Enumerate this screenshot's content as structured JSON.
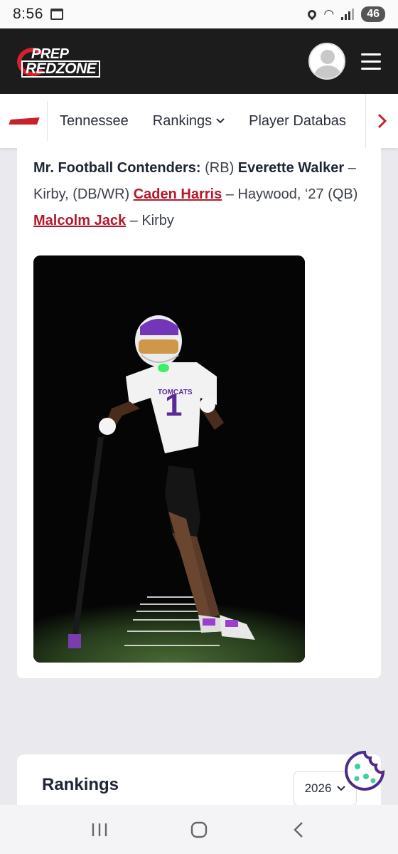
{
  "status_bar": {
    "time": "8:56",
    "battery": "46",
    "icons": [
      "calendar-icon",
      "location-icon",
      "wifi-icon",
      "signal-icon",
      "battery-icon"
    ]
  },
  "header": {
    "logo_line1": "PREP",
    "logo_line2": "REDZONE",
    "brand_color": "#d8202a",
    "icons": [
      "avatar-icon",
      "hamburger-menu-icon"
    ]
  },
  "nav": {
    "items": [
      {
        "label": "Tennessee",
        "chevron": false
      },
      {
        "label": "Rankings",
        "chevron": true
      },
      {
        "label": "Player Databas",
        "chevron": false
      }
    ],
    "next_icon": "chevron-right-icon"
  },
  "article": {
    "heading": "Mr. Football Contenders:",
    "seg1": " (RB) ",
    "name1": "Everette Walker",
    "seg2": " – Kirby, (DB/WR) ",
    "link1": "Caden Harris",
    "seg3": " – Haywood, ‘27 (QB) ",
    "link2": "Malcolm Jack",
    "seg4": " – Kirby",
    "link_color": "#b3192a",
    "photo_jersey_text": "TOMCATS",
    "photo_jersey_number": "1"
  },
  "rankings": {
    "title": "Rankings",
    "year_selected": "2026"
  },
  "system_nav": {
    "icons": [
      "recents-icon",
      "home-icon",
      "back-icon"
    ]
  }
}
